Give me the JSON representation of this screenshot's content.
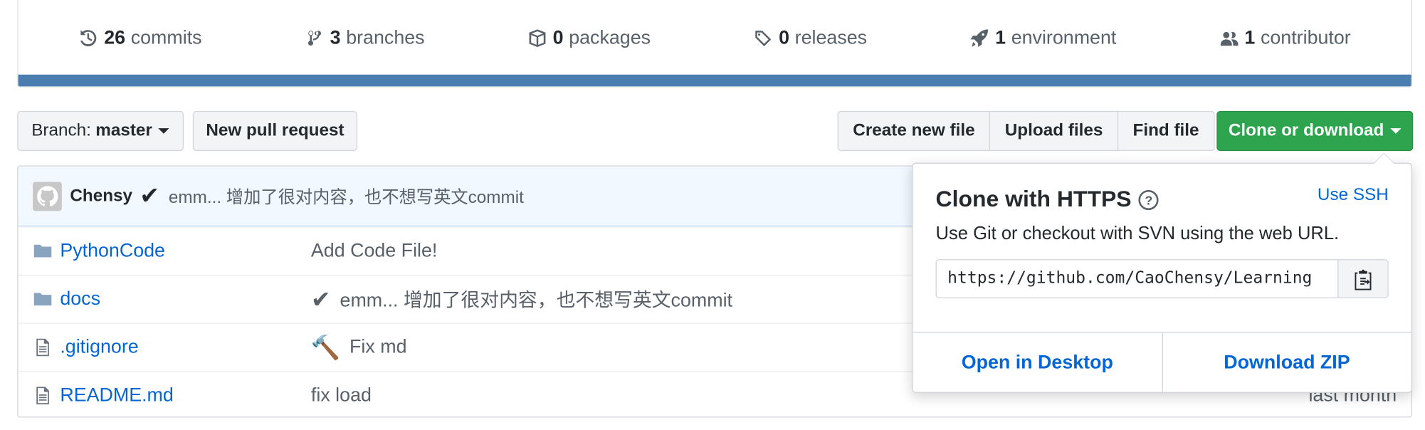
{
  "summary": {
    "commits": {
      "count": "26",
      "label": "commits"
    },
    "branches": {
      "count": "3",
      "label": "branches"
    },
    "packages": {
      "count": "0",
      "label": "packages"
    },
    "releases": {
      "count": "0",
      "label": "releases"
    },
    "environment": {
      "count": "1",
      "label": "environment"
    },
    "contributor": {
      "count": "1",
      "label": "contributor"
    },
    "language_bar_color": "#4a7db0"
  },
  "toolbar": {
    "branch_prefix": "Branch:",
    "branch_name": "master",
    "new_pull_request": "New pull request",
    "create_new_file": "Create new file",
    "upload_files": "Upload files",
    "find_file": "Find file",
    "clone_or_download": "Clone or download"
  },
  "latest_commit": {
    "author": "Chensy",
    "check": "✔",
    "message": "emm... 增加了很对内容，也不想写英文commit"
  },
  "files": [
    {
      "name": "PythonCode",
      "type": "folder",
      "emoji": "",
      "message": "Add Code File!",
      "age": ""
    },
    {
      "name": "docs",
      "type": "folder",
      "emoji": "✔",
      "message": "emm... 增加了很对内容，也不想写英文commit",
      "age": ""
    },
    {
      "name": ".gitignore",
      "type": "file",
      "emoji": "🔨",
      "message": "Fix md",
      "age": ""
    },
    {
      "name": "README.md",
      "type": "file",
      "emoji": "",
      "message": "fix load",
      "age": "last month"
    }
  ],
  "clone_dropdown": {
    "title": "Clone with HTTPS",
    "help": "?",
    "use_ssh": "Use SSH",
    "description": "Use Git or checkout with SVN using the web URL.",
    "url": "https://github.com/CaoChensy/Learning",
    "open_desktop": "Open in Desktop",
    "download_zip": "Download ZIP"
  },
  "colors": {
    "primary_green": "#2ea44f",
    "link_blue": "#0366d6"
  }
}
